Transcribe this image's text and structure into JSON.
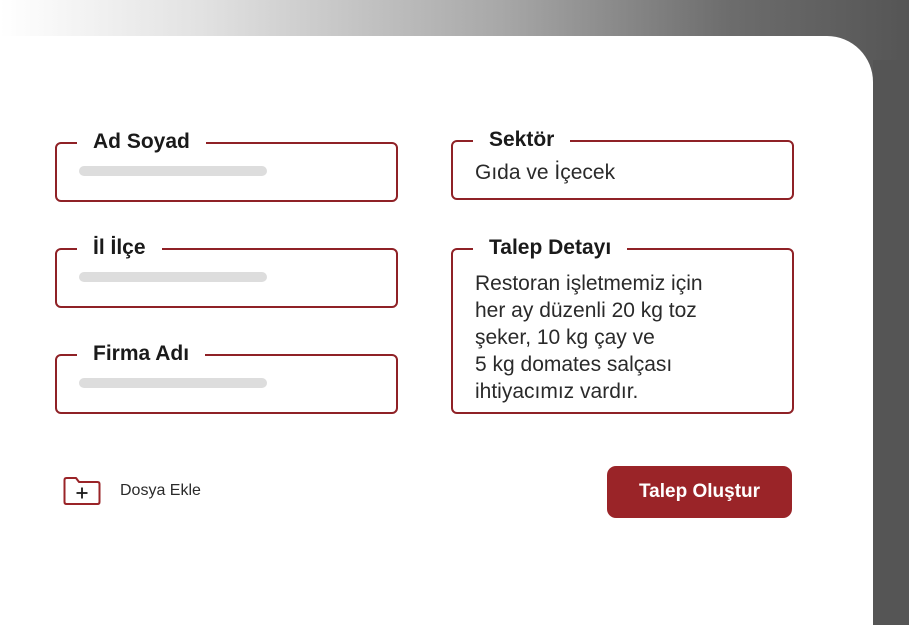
{
  "colors": {
    "accent": "#9a2428",
    "border": "#8f2126",
    "frame": "#555555",
    "placeholder": "#dddddd"
  },
  "form": {
    "name": {
      "label": "Ad Soyad"
    },
    "sector": {
      "label": "Sektör",
      "value": "Gıda ve İçecek"
    },
    "location": {
      "label": "İl İlçe"
    },
    "request": {
      "label": "Talep Detayı",
      "value": "Restoran işletmemiz için\nher ay düzenli 20 kg toz\nşeker, 10 kg çay ve\n5 kg domates salçası\nihtiyacımız vardır."
    },
    "company": {
      "label": "Firma Adı"
    }
  },
  "actions": {
    "attach_icon": "folder-plus-icon",
    "attach_label": "Dosya Ekle",
    "submit_label": "Talep Oluştur"
  }
}
